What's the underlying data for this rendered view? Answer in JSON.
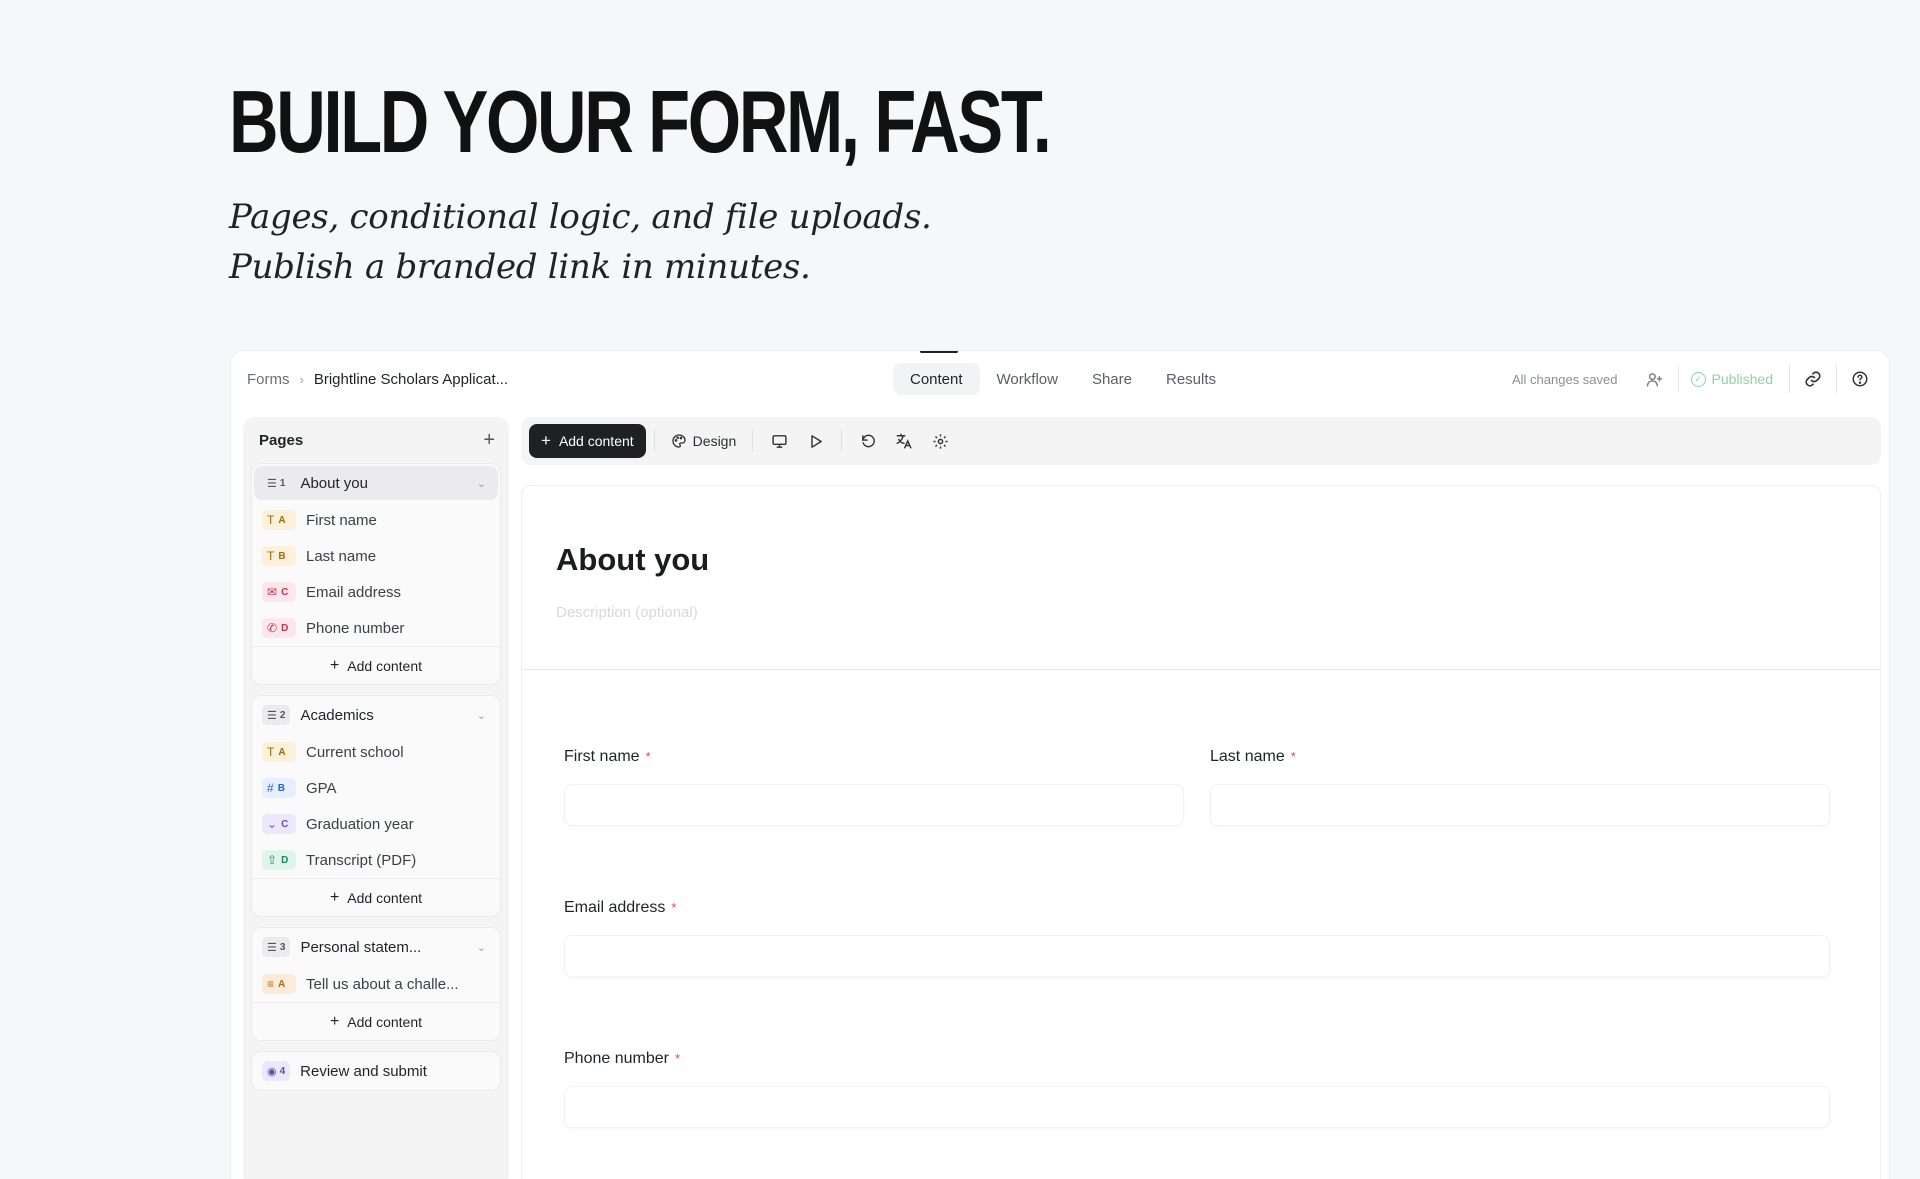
{
  "hero": {
    "title": "BUILD YOUR FORM, FAST.",
    "subtitle_line1": "Pages, conditional logic, and file uploads.",
    "subtitle_line2": "Publish a branded link in minutes."
  },
  "header": {
    "breadcrumb_root": "Forms",
    "breadcrumb_current": "Brightline Scholars Applicat...",
    "tabs": [
      {
        "label": "Content"
      },
      {
        "label": "Workflow"
      },
      {
        "label": "Share"
      },
      {
        "label": "Results"
      }
    ],
    "active_tab": "Content",
    "save_status": "All changes saved",
    "publish_status": "Published",
    "icons": [
      "invite-user-icon",
      "check-circle-icon",
      "link-icon",
      "help-icon"
    ]
  },
  "sidebar": {
    "title": "Pages",
    "add_label": "Add content",
    "pages": [
      {
        "number": "1",
        "title": "About you",
        "fields": [
          {
            "letter": "A",
            "label": "First name",
            "type": "text"
          },
          {
            "letter": "B",
            "label": "Last name",
            "type": "text"
          },
          {
            "letter": "C",
            "label": "Email address",
            "type": "email"
          },
          {
            "letter": "D",
            "label": "Phone number",
            "type": "phone"
          }
        ]
      },
      {
        "number": "2",
        "title": "Academics",
        "fields": [
          {
            "letter": "A",
            "label": "Current school",
            "type": "text"
          },
          {
            "letter": "B",
            "label": "GPA",
            "type": "number"
          },
          {
            "letter": "C",
            "label": "Graduation year",
            "type": "select"
          },
          {
            "letter": "D",
            "label": "Transcript (PDF)",
            "type": "upload"
          }
        ]
      },
      {
        "number": "3",
        "title": "Personal statem...",
        "fields": [
          {
            "letter": "A",
            "label": "Tell us about a challe...",
            "type": "long-text"
          }
        ]
      },
      {
        "number": "4",
        "title": "Review and submit"
      }
    ]
  },
  "toolbar": {
    "add_content": "Add content",
    "design": "Design",
    "icons": [
      "desktop-preview-icon",
      "play-icon",
      "undo-icon",
      "translate-icon",
      "settings-icon"
    ]
  },
  "canvas": {
    "page_title": "About you",
    "description_placeholder": "Description (optional)",
    "questions": [
      {
        "label": "First name",
        "required": "*"
      },
      {
        "label": "Last name",
        "required": "*"
      },
      {
        "label": "Email address",
        "required": "*"
      },
      {
        "label": "Phone number",
        "required": "*"
      }
    ]
  }
}
